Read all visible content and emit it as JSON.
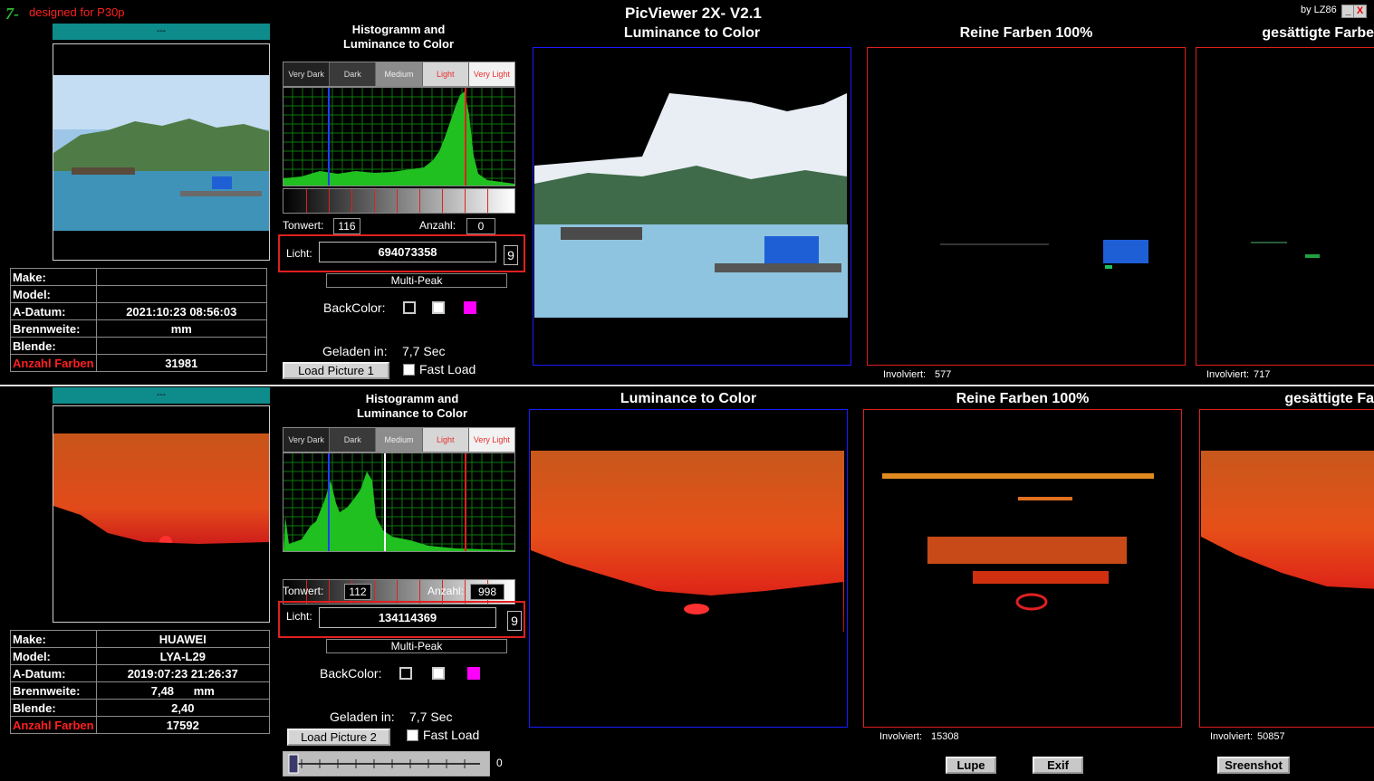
{
  "app": {
    "logo": "7-",
    "tagline": "designed for P30p",
    "title": "PicViewer 2X- V2.1",
    "by": "by LZ86",
    "minimize": "_",
    "close": "X"
  },
  "top": {
    "thumb_header": "---",
    "info": [
      {
        "label": "Make:",
        "value": ""
      },
      {
        "label": "Model:",
        "value": ""
      },
      {
        "label": "A-Datum:",
        "value": "2021:10:23 08:56:03"
      },
      {
        "label": "Brennweite:",
        "value": "mm"
      },
      {
        "label": "Blende:",
        "value": ""
      }
    ],
    "colors_label": "Anzahl Farben",
    "colors_value": "31981",
    "hist_title_1": "Histogramm and",
    "hist_title_2": "Luminance to Color",
    "lum": [
      "Very Dark",
      "Dark",
      "Medium",
      "Light",
      "Very Light"
    ],
    "tonwert_label": "Tonwert:",
    "tonwert_value": "116",
    "anzahl_label": "Anzahl:",
    "anzahl_value": "0",
    "licht_label": "Licht:",
    "licht_value": "694073358",
    "licht_steps": "9",
    "multipeak": "Multi-Peak",
    "backcolor_label": "BackColor:",
    "geladen_label": "Geladen in:",
    "geladen_value": "7,7 Sec",
    "load_button": "Load Picture 1",
    "fast_load": "Fast Load",
    "panel1_title": "Luminance to Color",
    "panel2_title": "Reine Farben 100%",
    "panel3_title": "gesättigte Farbe",
    "involv_label": "Involviert:",
    "involv2": "577",
    "involv3": "717"
  },
  "bottom": {
    "thumb_header": "---",
    "info": [
      {
        "label": "Make:",
        "value": "HUAWEI"
      },
      {
        "label": "Model:",
        "value": "LYA-L29"
      },
      {
        "label": "A-Datum:",
        "value": "2019:07:23 21:26:37"
      },
      {
        "label": "Brennweite:",
        "value": "7,48",
        "unit": "mm"
      },
      {
        "label": "Blende:",
        "value": "2,40"
      }
    ],
    "colors_label": "Anzahl Farben",
    "colors_value": "17592",
    "hist_title_1": "Histogramm and",
    "hist_title_2": "Luminance to Color",
    "lum": [
      "Very Dark",
      "Dark",
      "Medium",
      "Light",
      "Very Light"
    ],
    "tonwert_label": "Tonwert:",
    "tonwert_value": "112",
    "anzahl_label": "Anzahl:",
    "anzahl_value": "998",
    "licht_label": "Licht:",
    "licht_value": "134114369",
    "licht_steps": "9",
    "multipeak": "Multi-Peak",
    "backcolor_label": "BackColor:",
    "geladen_label": "Geladen in:",
    "geladen_value": "7,7 Sec",
    "load_button": "Load Picture 2",
    "fast_load": "Fast Load",
    "panel1_title": "Luminance to Color",
    "panel2_title": "Reine Farben 100%",
    "panel3_title": "gesättigte Fa",
    "involv_label": "Involviert:",
    "involv2": "15308",
    "involv3": "50857",
    "slider_value": "0"
  },
  "buttons": {
    "lupe": "Lupe",
    "exif": "Exif",
    "screenshot": "Sreenshot"
  },
  "colors": {
    "accent_red": "#e02020",
    "teal": "#0e8c8c",
    "hist_green": "#20c020",
    "swatch_magenta": "#ff00ff"
  }
}
